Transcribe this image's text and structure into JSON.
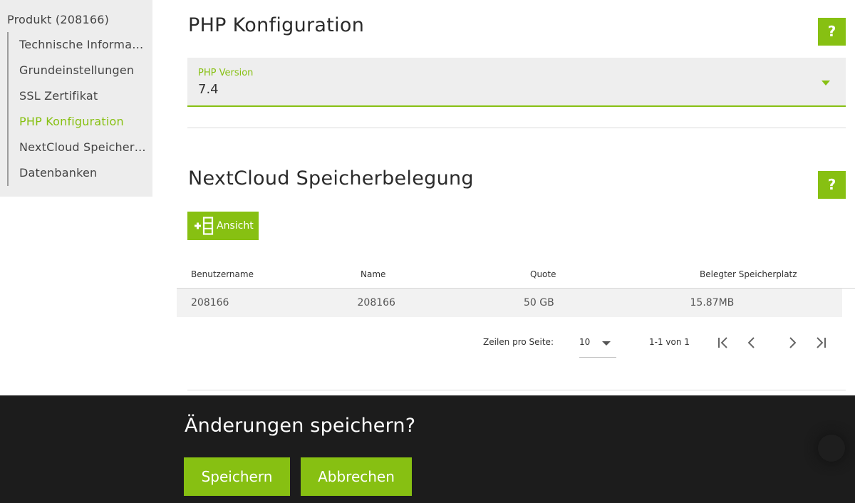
{
  "sidebar": {
    "title": "Produkt (208166)",
    "items": [
      {
        "label": "Technische Informationen",
        "active": false
      },
      {
        "label": "Grundeinstellungen",
        "active": false
      },
      {
        "label": "SSL Zertifikat",
        "active": false
      },
      {
        "label": "PHP Konfiguration",
        "active": true
      },
      {
        "label": "NextCloud Speicherbelegung",
        "active": false
      },
      {
        "label": "Datenbanken",
        "active": false
      }
    ]
  },
  "php_section": {
    "title": "PHP Konfiguration",
    "help_label": "?",
    "version_field": {
      "label": "PHP Version",
      "value": "7.4"
    }
  },
  "nextcloud_section": {
    "title": "NextCloud Speicherbelegung",
    "help_label": "?",
    "view_button_label": "Ansicht",
    "table": {
      "columns": [
        "Benutzername",
        "Name",
        "Quote",
        "Belegter Speicherplatz"
      ],
      "rows": [
        [
          "208166",
          "208166",
          "50 GB",
          "15.87MB"
        ]
      ]
    },
    "pagination": {
      "rows_per_page_label": "Zeilen pro Seite:",
      "rows_per_page_value": "10",
      "range": "1-1 von 1"
    }
  },
  "save_bar": {
    "title": "Änderungen speichern?",
    "save_label": "Speichern",
    "cancel_label": "Abbrechen"
  },
  "colors": {
    "accent": "#87c012",
    "sidebar_bg": "#ededed",
    "bar_bg": "#1c1c1c"
  },
  "icons": {
    "select_arrow": "caret-down-icon",
    "view": "add-columns-icon",
    "first_page": "first-page-icon",
    "prev_page": "chevron-left-icon",
    "next_page": "chevron-right-icon",
    "last_page": "last-page-icon"
  }
}
